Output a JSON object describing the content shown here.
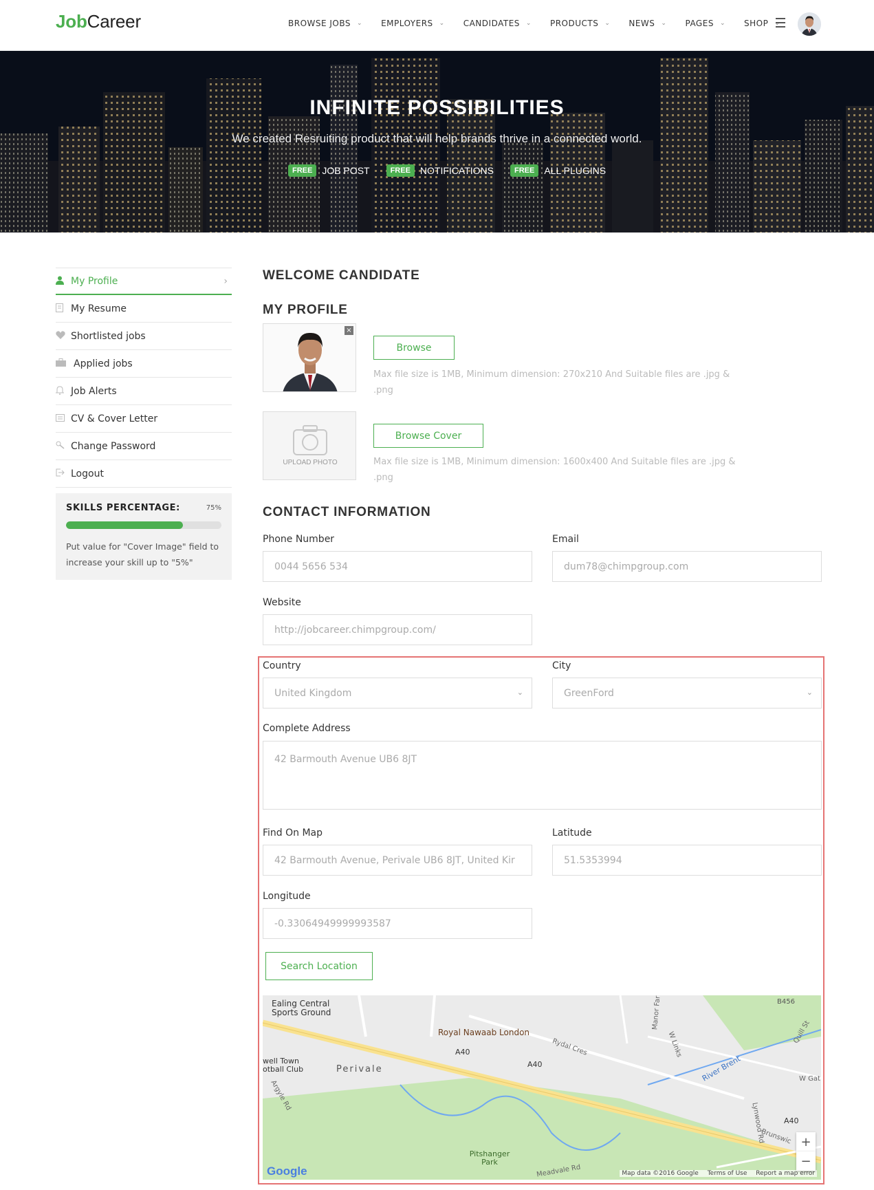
{
  "brand": {
    "prefix": "Job",
    "suffix": "Career"
  },
  "nav": {
    "items": [
      {
        "label": "BROWSE JOBS"
      },
      {
        "label": "EMPLOYERS"
      },
      {
        "label": "CANDIDATES"
      },
      {
        "label": "PRODUCTS"
      },
      {
        "label": "NEWS"
      },
      {
        "label": "PAGES"
      },
      {
        "label": "SHOP"
      }
    ]
  },
  "hero": {
    "title": "INFINITE POSSIBILITIES",
    "subtitle": "We created Resruiting product that will help brands thrive in a connected world.",
    "features": [
      {
        "badge": "FREE",
        "label": "JOB POST"
      },
      {
        "badge": "FREE",
        "label": "NOTIFICATIONS"
      },
      {
        "badge": "FREE",
        "label": "ALL PLUGINS"
      }
    ]
  },
  "sidebar": {
    "items": [
      {
        "label": "My Profile"
      },
      {
        "label": "My Resume"
      },
      {
        "label": "Shortlisted jobs"
      },
      {
        "label": "Applied jobs"
      },
      {
        "label": "Job Alerts"
      },
      {
        "label": "CV & Cover Letter"
      },
      {
        "label": "Change Password"
      },
      {
        "label": "Logout"
      }
    ],
    "skills": {
      "title": "SKILLS PERCENTAGE:",
      "percent_text": "75%",
      "percent": 75,
      "note": "Put value for \"Cover Image\" field to increase your skill up to \"5%\""
    }
  },
  "main": {
    "welcome": "WELCOME CANDIDATE",
    "profile_title": "MY PROFILE",
    "browse_label": "Browse",
    "photo_hint": "Max file size is 1MB, Minimum dimension: 270x210 And Suitable files are .jpg & .png",
    "upload_label": "UPLOAD PHOTO",
    "browse_cover_label": "Browse Cover",
    "cover_hint": "Max file size is 1MB, Minimum dimension: 1600x400 And Suitable files are .jpg & .png",
    "contact_title": "CONTACT INFORMATION"
  },
  "form": {
    "phone": {
      "label": "Phone Number",
      "value": "0044 5656 534"
    },
    "email": {
      "label": "Email",
      "value": "dum78@chimpgroup.com"
    },
    "website": {
      "label": "Website",
      "value": "http://jobcareer.chimpgroup.com/"
    },
    "country": {
      "label": "Country",
      "value": "United Kingdom"
    },
    "city": {
      "label": "City",
      "value": "GreenFord"
    },
    "address": {
      "label": "Complete Address",
      "value": "42 Barmouth Avenue UB6 8JT"
    },
    "find_on_map": {
      "label": "Find On Map",
      "value": "42 Barmouth Avenue, Perivale UB6 8JT, United Kir"
    },
    "latitude": {
      "label": "Latitude",
      "value": "51.5353994"
    },
    "longitude": {
      "label": "Longitude",
      "value": "-0.33064949999993587"
    },
    "search_label": "Search Location"
  },
  "map": {
    "labels": {
      "ealing": "Ealing Central Sports Ground",
      "nawaab": "Royal Nawaab London",
      "perivale": "Perivale",
      "a40_1": "A40",
      "a40_2": "A40",
      "a40_3": "A40",
      "river": "River Brent",
      "pitshanger": "Pitshanger Park",
      "town": "well Town otball Club",
      "b456": "B456",
      "rydal": "Rydal Cres",
      "manor": "Manor Far",
      "wlinks": "W Links",
      "quill": "Quill St",
      "wgat": "W Gat",
      "lynwood": "Lynwood Rd",
      "brunswick": "Brunswic",
      "argyle": "Argyle Rd",
      "meadvale": "Meadvale Rd",
      "google": "Google",
      "mapdata": "Map data ©2016 Google",
      "terms": "Terms of Use",
      "report": "Report a map error"
    },
    "zoom_in": "+",
    "zoom_out": "−"
  },
  "colors": {
    "accent": "#4caf50",
    "highlight": "#e57373"
  }
}
